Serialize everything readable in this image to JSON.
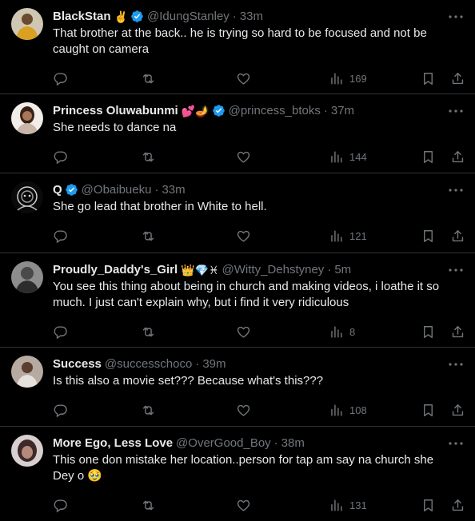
{
  "replies": [
    {
      "display_name": "BlackStan",
      "name_emoji": "✌️",
      "verified": true,
      "handle": "@IdungStanley",
      "separator": "·",
      "time": "33m",
      "text": "That brother at the back.. he is trying so hard to be focused and not be caught on camera",
      "views": "169"
    },
    {
      "display_name": "Princess Oluwabunmi",
      "name_emoji": "💕🪔",
      "verified": true,
      "handle": "@princess_btoks",
      "separator": "·",
      "time": "37m",
      "text": "She needs to dance na",
      "views": "144"
    },
    {
      "display_name": "Q",
      "name_emoji": "",
      "verified": true,
      "handle": "@Obaibueku",
      "separator": "·",
      "time": "33m",
      "text": "She go lead that brother in White to hell.",
      "views": "121"
    },
    {
      "display_name": "Proudly_Daddy's_Girl",
      "name_emoji": "👑💎♓",
      "verified": false,
      "handle": "@Witty_Dehstyney",
      "separator": "·",
      "time": "5m",
      "text": "You see this thing about being in church and making videos, i loathe it so much. I just can't explain why, but i find it very ridiculous",
      "views": "8"
    },
    {
      "display_name": "Success",
      "name_emoji": "",
      "verified": false,
      "handle": "@successchoco",
      "separator": "·",
      "time": "39m",
      "text": "Is this also a movie set??? Because what's this???",
      "views": "108"
    },
    {
      "display_name": "More Ego, Less Love",
      "name_emoji": "",
      "verified": false,
      "handle": "@OverGood_Boy",
      "separator": "·",
      "time": "38m",
      "text": "This one don mistake her location..person for tap am say na church she Dey o 🥹",
      "views": "131"
    }
  ],
  "colors": {
    "background": "#000000",
    "text": "#e7e9ea",
    "muted": "#71767b",
    "divider": "#2f3336",
    "verified": "#1d9bf0"
  },
  "icons": [
    "more-icon",
    "reply-icon",
    "retweet-icon",
    "like-icon",
    "views-icon",
    "bookmark-icon",
    "share-icon",
    "verified-icon"
  ]
}
